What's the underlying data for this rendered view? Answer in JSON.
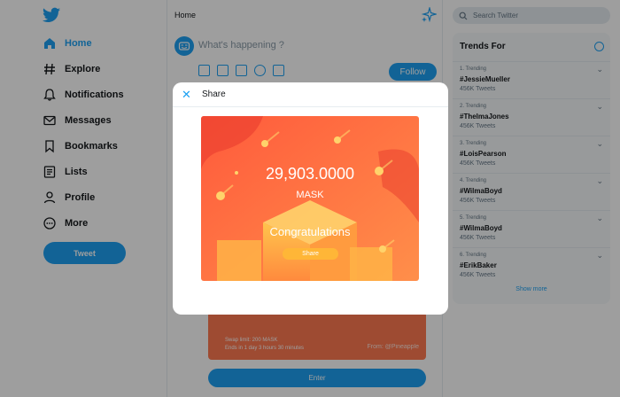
{
  "sidebar": {
    "items": [
      {
        "label": "Home",
        "icon": "home-icon"
      },
      {
        "label": "Explore",
        "icon": "hashtag-icon"
      },
      {
        "label": "Notifications",
        "icon": "bell-icon"
      },
      {
        "label": "Messages",
        "icon": "envelope-icon"
      },
      {
        "label": "Bookmarks",
        "icon": "bookmark-icon"
      },
      {
        "label": "Lists",
        "icon": "list-icon"
      },
      {
        "label": "Profile",
        "icon": "person-icon"
      },
      {
        "label": "More",
        "icon": "more-icon"
      }
    ],
    "tweet_label": "Tweet"
  },
  "feed": {
    "title": "Home",
    "compose_placeholder": "What's happening ?",
    "follow_label": "Follow",
    "card": {
      "swap_limit": "Swap limit:  200 MASK",
      "ends_in": "Ends in 1 day 3 hours 30 minutes",
      "from": "From: @Pineapple"
    },
    "enter_label": "Enter"
  },
  "search": {
    "placeholder": "Search Twitter"
  },
  "trends": {
    "title": "Trends For",
    "items": [
      {
        "category": "1. Trending",
        "tag": "#JessieMueller",
        "count": "456K Tweets"
      },
      {
        "category": "2. Trending",
        "tag": "#ThelmaJones",
        "count": "456K Tweets"
      },
      {
        "category": "3. Trending",
        "tag": "#LoisPearson",
        "count": "456K Tweets"
      },
      {
        "category": "4. Trending",
        "tag": "#WilmaBoyd",
        "count": "456K Tweets"
      },
      {
        "category": "5. Trending",
        "tag": "#WilmaBoyd",
        "count": "456K Tweets"
      },
      {
        "category": "6. Trending",
        "tag": "#ErikBaker",
        "count": "456K Tweets"
      }
    ],
    "show_more": "Show more"
  },
  "modal": {
    "title": "Share",
    "amount": "29,903.0000",
    "token": "MASK",
    "message": "Congratulations",
    "share_label": "Share"
  },
  "colors": {
    "accent": "#1da1f2",
    "promo_gradient_start": "#ff5e3a",
    "promo_gradient_end": "#ff9a4d",
    "share_button": "#ffb637"
  }
}
